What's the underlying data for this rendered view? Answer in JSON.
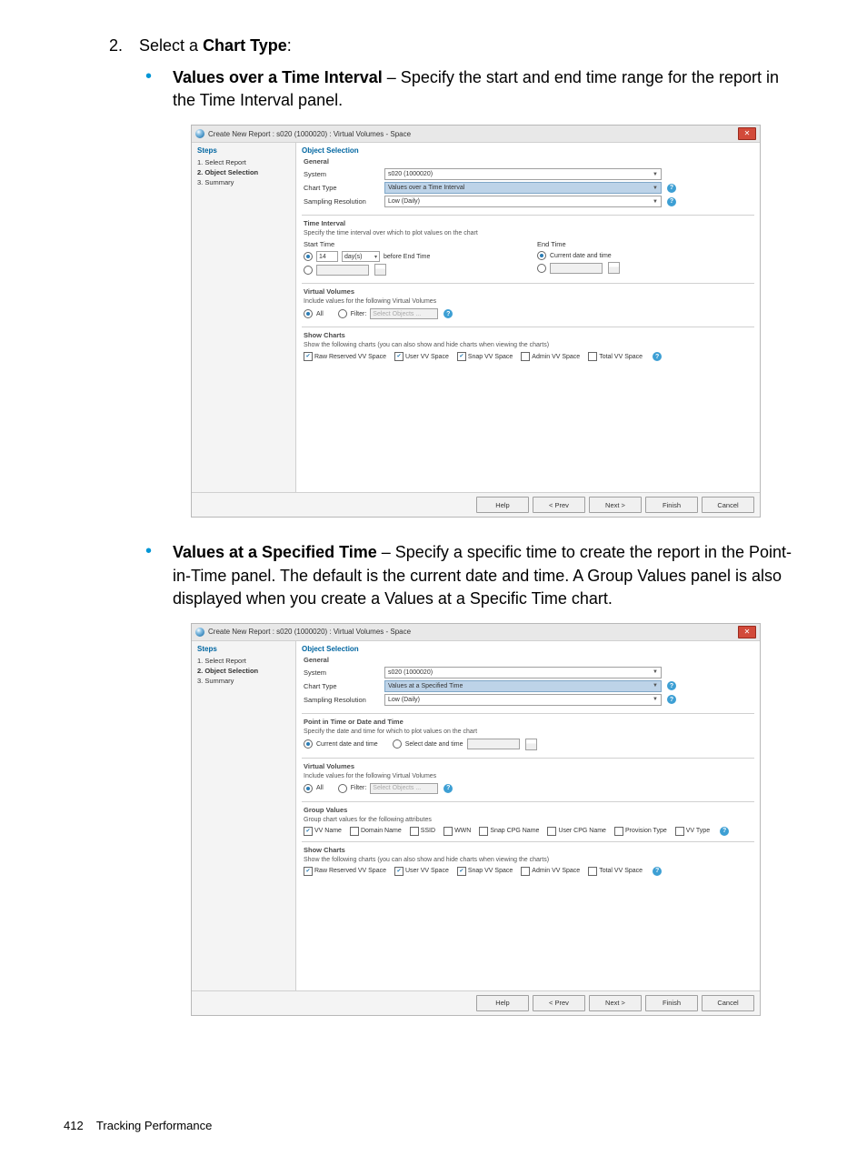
{
  "doc": {
    "step_number": "2.",
    "step_text": "Select a ",
    "step_bold": "Chart Type",
    "step_colon": ":",
    "bullet1_bold": "Values over a Time Interval",
    "bullet1_rest": " – Specify the start and end time range for the report in the Time Interval panel.",
    "bullet2_bold": "Values at a Specified Time",
    "bullet2_rest": " – Specify a specific time to create the report in the Point-in-Time panel. The default is the current date and time. A Group Values panel is also displayed when you create a Values at a Specific Time chart.",
    "footer_page": "412",
    "footer_text": "Tracking Performance"
  },
  "dlg1": {
    "title": "Create New Report : s020 (1000020) : Virtual Volumes - Space",
    "steps_head": "Steps",
    "steps": [
      "1. Select Report",
      "2. Object Selection",
      "3. Summary"
    ],
    "content_head": "Object Selection",
    "general": {
      "title": "General",
      "system_label": "System",
      "system_value": "s020 (1000020)",
      "chart_label": "Chart Type",
      "chart_value": "Values over a Time Interval",
      "sampling_label": "Sampling Resolution",
      "sampling_value": "Low (Daily)"
    },
    "time_interval": {
      "title": "Time Interval",
      "desc": "Specify the time interval over which to plot values on the chart",
      "start_label": "Start Time",
      "end_label": "End Time",
      "start_row1_value": "14",
      "start_row1_unit": "day(s)",
      "start_row1_suffix": "before End Time",
      "end_row1": "Current date and time"
    },
    "vv": {
      "title": "Virtual Volumes",
      "desc": "Include values for the following Virtual Volumes",
      "all": "All",
      "filter": "Filter:",
      "filter_placeholder": "Select Objects ..."
    },
    "charts": {
      "title": "Show Charts",
      "desc": "Show the following charts (you can also show and hide charts when viewing the charts)",
      "items": [
        "Raw Reserved VV Space",
        "User VV Space",
        "Snap VV Space",
        "Admin VV Space",
        "Total VV Space"
      ]
    },
    "buttons": {
      "help": "Help",
      "prev": "< Prev",
      "next": "Next >",
      "finish": "Finish",
      "cancel": "Cancel"
    }
  },
  "dlg2": {
    "title": "Create New Report : s020 (1000020) : Virtual Volumes - Space",
    "steps_head": "Steps",
    "steps": [
      "1. Select Report",
      "2. Object Selection",
      "3. Summary"
    ],
    "content_head": "Object Selection",
    "general": {
      "title": "General",
      "system_label": "System",
      "system_value": "s020 (1000020)",
      "chart_label": "Chart Type",
      "chart_value": "Values at a Specified Time",
      "sampling_label": "Sampling Resolution",
      "sampling_value": "Low (Daily)"
    },
    "pit": {
      "title": "Point in Time or Date and Time",
      "desc": "Specify the date and time for which to plot values on the chart",
      "current": "Current date and time",
      "select": "Select date and time"
    },
    "vv": {
      "title": "Virtual Volumes",
      "desc": "Include values for the following Virtual Volumes",
      "all": "All",
      "filter": "Filter:",
      "filter_placeholder": "Select Objects ..."
    },
    "group": {
      "title": "Group Values",
      "desc": "Group chart values for the following attributes",
      "items": [
        "VV Name",
        "Domain Name",
        "SSID",
        "WWN",
        "Snap CPG Name",
        "User CPG Name",
        "Provision Type",
        "VV Type"
      ]
    },
    "charts": {
      "title": "Show Charts",
      "desc": "Show the following charts (you can also show and hide charts when viewing the charts)",
      "items": [
        "Raw Reserved VV Space",
        "User VV Space",
        "Snap VV Space",
        "Admin VV Space",
        "Total VV Space"
      ]
    },
    "buttons": {
      "help": "Help",
      "prev": "< Prev",
      "next": "Next >",
      "finish": "Finish",
      "cancel": "Cancel"
    }
  }
}
